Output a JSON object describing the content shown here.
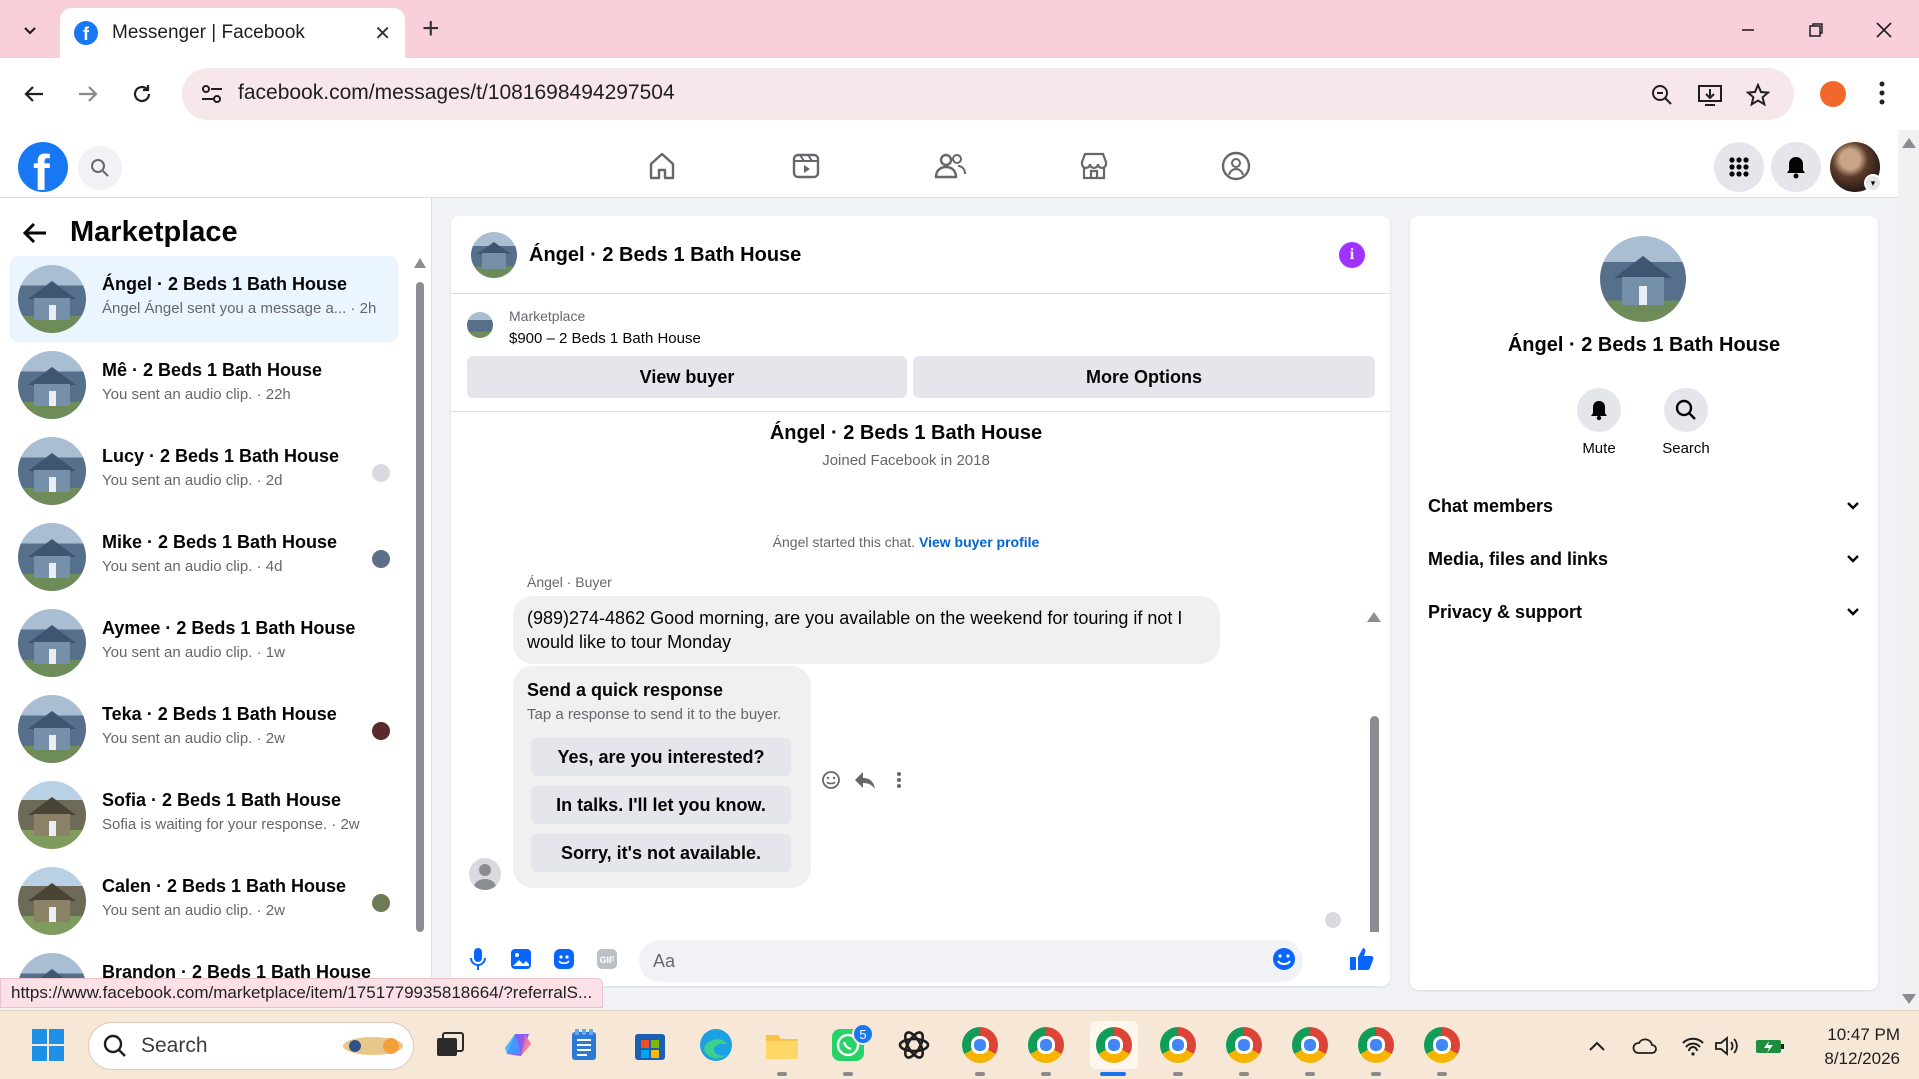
{
  "browser": {
    "tab_title": "Messenger | Facebook",
    "url": "facebook.com/messages/t/1081698494297504",
    "status_url": "https://www.facebook.com/marketplace/item/1751779935818664/?referralS..."
  },
  "fb": {
    "logo": "f"
  },
  "sidebar": {
    "title": "Marketplace",
    "chats": [
      {
        "name": "Ángel · 2 Beds 1 Bath House",
        "preview": "Ángel Ángel sent you a message a... · 2h",
        "thumb": "house-blue",
        "active": true
      },
      {
        "name": "Mê · 2 Beds 1 Bath House",
        "preview": "You sent an audio clip. · 22h",
        "thumb": "house-blue"
      },
      {
        "name": "Lucy · 2 Beds 1 Bath House",
        "preview": "You sent an audio clip. · 2d",
        "thumb": "house-blue"
      },
      {
        "name": "Mike · 2 Beds 1 Bath House",
        "preview": "You sent an audio clip. · 4d",
        "thumb": "house-blue"
      },
      {
        "name": "Aymee · 2 Beds 1 Bath House",
        "preview": "You sent an audio clip. · 1w",
        "thumb": "house-blue"
      },
      {
        "name": "Teka · 2 Beds 1 Bath House",
        "preview": "You sent an audio clip. · 2w",
        "thumb": "house-blue"
      },
      {
        "name": "Sofia · 2 Beds 1 Bath House",
        "preview": "Sofia is waiting for your response. · 2w",
        "thumb": "house-green"
      },
      {
        "name": "Calen · 2 Beds 1 Bath House",
        "preview": "You sent an audio clip. · 2w",
        "thumb": "house-green"
      },
      {
        "name": "Brandon · 2 Beds 1 Bath House",
        "preview": "",
        "thumb": "house-blue"
      }
    ]
  },
  "conversation": {
    "header_name": "Ángel · 2 Beds 1 Bath House",
    "marketplace_label": "Marketplace",
    "listing": "$900 – 2 Beds 1 Bath House",
    "view_buyer": "View buyer",
    "more_options": "More Options",
    "intro_name": "Ángel · 2 Beds 1 Bath House",
    "joined": "Joined Facebook in 2018",
    "started_text": "Ángel started this chat.",
    "view_profile": "View buyer profile",
    "sender_label": "Ángel · Buyer",
    "message": "(989)274-4862 Good morning, are you available on the weekend for touring if not I would like to tour Monday",
    "quick_title": "Send a quick response",
    "quick_sub": "Tap a response to send it to the buyer.",
    "quick_replies": [
      "Yes, are you interested?",
      "In talks. I'll let you know.",
      "Sorry, it's not available."
    ],
    "composer_placeholder": "Aa"
  },
  "info": {
    "name": "Ángel · 2 Beds 1 Bath House",
    "mute": "Mute",
    "search": "Search",
    "sections": [
      "Chat members",
      "Media, files and links",
      "Privacy & support"
    ]
  },
  "taskbar": {
    "search_placeholder": "Search",
    "whatsapp_badge": "5",
    "time": "10:47 PM",
    "date": "8/12/2026"
  },
  "colors": {
    "fb_blue": "#1877f2",
    "messenger_purple": "#a033ff",
    "tab_strip": "#f9d0d9"
  }
}
